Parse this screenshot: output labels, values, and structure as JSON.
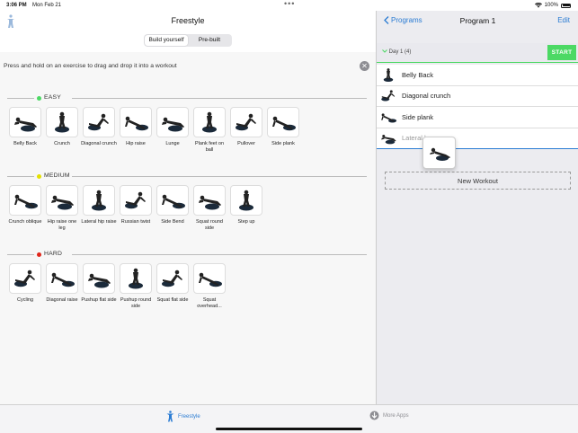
{
  "status": {
    "time": "3:06 PM",
    "date": "Mon Feb 21",
    "battery": "100%"
  },
  "left": {
    "title": "Freestyle",
    "segments": [
      {
        "label": "Build yourself",
        "active": true
      },
      {
        "label": "Pre-built",
        "active": false
      }
    ],
    "hint": "Press and hold on an exercise to drag and drop it into a workout",
    "sections": [
      {
        "label": "EASY",
        "color": "#4cd964",
        "items": [
          "Belly Back",
          "Crunch",
          "Diagonal crunch",
          "Hip raise",
          "Lunge",
          "Plank feet on ball",
          "Pullover",
          "Side plank"
        ]
      },
      {
        "label": "MEDIUM",
        "color": "#e4e000",
        "items": [
          "Crunch oblique",
          "Hip raise one leg",
          "Lateral hip raise",
          "Russian twist",
          "Side Bend",
          "Squat round side",
          "Step up"
        ]
      },
      {
        "label": "HARD",
        "color": "#e0261b",
        "items": [
          "Cycling",
          "Diagonal raise",
          "Pushup flat side",
          "Pushup round side",
          "Squat flat side",
          "Squat overhead..."
        ]
      }
    ]
  },
  "right": {
    "back_label": "Programs",
    "title": "Program 1",
    "edit_label": "Edit",
    "day_label": "Day 1 (4)",
    "start_label": "START",
    "exercises": [
      "Belly Back",
      "Diagonal crunch",
      "Side plank",
      "Lateral h"
    ],
    "new_workout_label": "New Workout"
  },
  "tabbar": {
    "freestyle": "Freestyle",
    "more_apps": "More Apps"
  },
  "colors": {
    "accent": "#2b7cd3",
    "start_green": "#4cd964"
  }
}
